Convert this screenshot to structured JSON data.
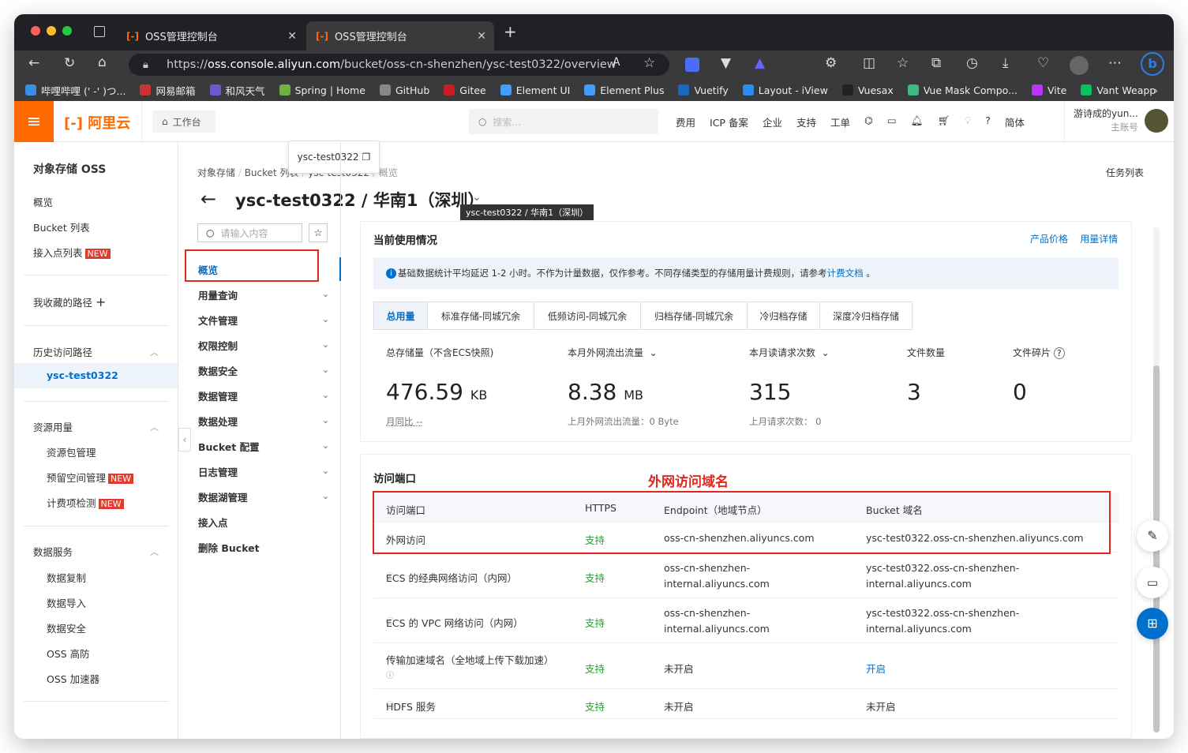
{
  "browser": {
    "tabs": [
      {
        "label": "OSS管理控制台",
        "icon_text": "[-]"
      },
      {
        "label": "OSS管理控制台",
        "icon_text": "[-]"
      }
    ],
    "url_prefix": "https://",
    "url_host": "oss.console.aliyun.com",
    "url_path": "/bucket/oss-cn-shenzhen/ysc-test0322/overview",
    "bookmarks": [
      "哔哩哔哩 (' -' )つ...",
      "网易邮箱",
      "和风天气",
      "Spring | Home",
      "GitHub",
      "Gitee",
      "Element UI",
      "Element Plus",
      "Vuetify",
      "Layout - iView",
      "Vuesax",
      "Vue Mask Compo...",
      "Vite",
      "Vant Weapp"
    ],
    "bookmark_colors": [
      "#3a8ee6",
      "#c33",
      "#6a5acd",
      "#6db33f",
      "#888",
      "#c71d23",
      "#409eff",
      "#409eff",
      "#1867c0",
      "#2d8cf0",
      "#222",
      "#41b883",
      "#bd34fe",
      "#07c160"
    ]
  },
  "header": {
    "logo": "阿里云",
    "workbench": "工作台",
    "search_placeholder": "搜索...",
    "nav": [
      "费用",
      "ICP 备案",
      "企业",
      "支持",
      "工单"
    ],
    "lang": "简体",
    "user_name": "游诗成的yun...",
    "user_role": "主账号"
  },
  "sidebar": {
    "title": "对象存储 OSS",
    "items": [
      "概览",
      "Bucket 列表",
      "接入点列表"
    ],
    "new_badge": "NEW",
    "favorites": "我收藏的路径",
    "history_title": "历史访问路径",
    "history_item": "ysc-test0322",
    "resource_title": "资源用量",
    "resource_items": [
      "资源包管理",
      "预留空间管理",
      "计费项检测"
    ],
    "data_title": "数据服务",
    "data_items": [
      "数据复制",
      "数据导入",
      "数据安全",
      "OSS 高防",
      "OSS 加速器"
    ]
  },
  "bucket_nav": {
    "search_placeholder": "请输入内容",
    "items": [
      "概览",
      "用量查询",
      "文件管理",
      "权限控制",
      "数据安全",
      "数据管理",
      "数据处理",
      "Bucket 配置",
      "日志管理",
      "数据湖管理",
      "接入点",
      "删除 Bucket"
    ]
  },
  "page": {
    "breadcrumb": [
      "对象存储",
      "Bucket 列表",
      "ysc-test0322",
      "概览"
    ],
    "tooltip": "ysc-test0322",
    "title": "ysc-test0322 / 华南1（深圳）",
    "title_tooltip": "ysc-test0322 / 华南1（深圳）",
    "task_list": "任务列表"
  },
  "usage": {
    "title": "当前使用情况",
    "links": [
      "产品价格",
      "用量详情"
    ],
    "notice": "基础数据统计平均延迟 1-2 小时。不作为计量数据，仅作参考。不同存储类型的存储用量计费规则，请参考",
    "notice_link": "计费文档",
    "notice_tail": "。",
    "tabs": [
      "总用量",
      "标准存储-同城冗余",
      "低频访问-同城冗余",
      "归档存储-同城冗余",
      "冷归档存储",
      "深度冷归档存储"
    ],
    "metrics": [
      {
        "label": "总存储量（不含ECS快照)",
        "value": "476.59",
        "unit": "KB",
        "sub": "月同比 --"
      },
      {
        "label": "本月外网流出流量",
        "value": "8.38",
        "unit": "MB",
        "sub": "上月外网流出流量：0 Byte"
      },
      {
        "label": "本月读请求次数",
        "value": "315",
        "unit": "",
        "sub": "上月请求次数：  0"
      },
      {
        "label": "文件数量",
        "value": "3",
        "unit": "",
        "sub": ""
      },
      {
        "label": "文件碎片",
        "value": "0",
        "unit": "",
        "sub": ""
      }
    ]
  },
  "endpoints": {
    "title": "访问端口",
    "annotation": "外网访问域名",
    "headers": [
      "访问端口",
      "HTTPS",
      "Endpoint（地域节点）",
      "Bucket 域名"
    ],
    "rows": [
      {
        "port": "外网访问",
        "https": "支持",
        "endpoint": "oss-cn-shenzhen.aliyuncs.com",
        "endpoint2": "",
        "domain": "ysc-test0322.oss-cn-shenzhen.aliyuncs.com",
        "domain2": ""
      },
      {
        "port": "ECS 的经典网络访问（内网）",
        "https": "支持",
        "endpoint": "oss-cn-shenzhen-",
        "endpoint2": "internal.aliyuncs.com",
        "domain": "ysc-test0322.oss-cn-shenzhen-",
        "domain2": "internal.aliyuncs.com"
      },
      {
        "port": "ECS 的 VPC 网络访问（内网）",
        "https": "支持",
        "endpoint": "oss-cn-shenzhen-",
        "endpoint2": "internal.aliyuncs.com",
        "domain": "ysc-test0322.oss-cn-shenzhen-",
        "domain2": "internal.aliyuncs.com"
      },
      {
        "port": "传输加速域名（全地域上传下载加速）",
        "https": "支持",
        "endpoint": "未开启",
        "endpoint2": "",
        "domain": "开启",
        "domain2": ""
      },
      {
        "port": "HDFS 服务",
        "https": "支持",
        "endpoint": "未开启",
        "endpoint2": "",
        "domain": "未开启",
        "domain2": ""
      }
    ]
  },
  "colors": {
    "brand": "#ff6a00",
    "link": "#0070cc",
    "support": "#26a033",
    "highlight": "#e0281f"
  }
}
